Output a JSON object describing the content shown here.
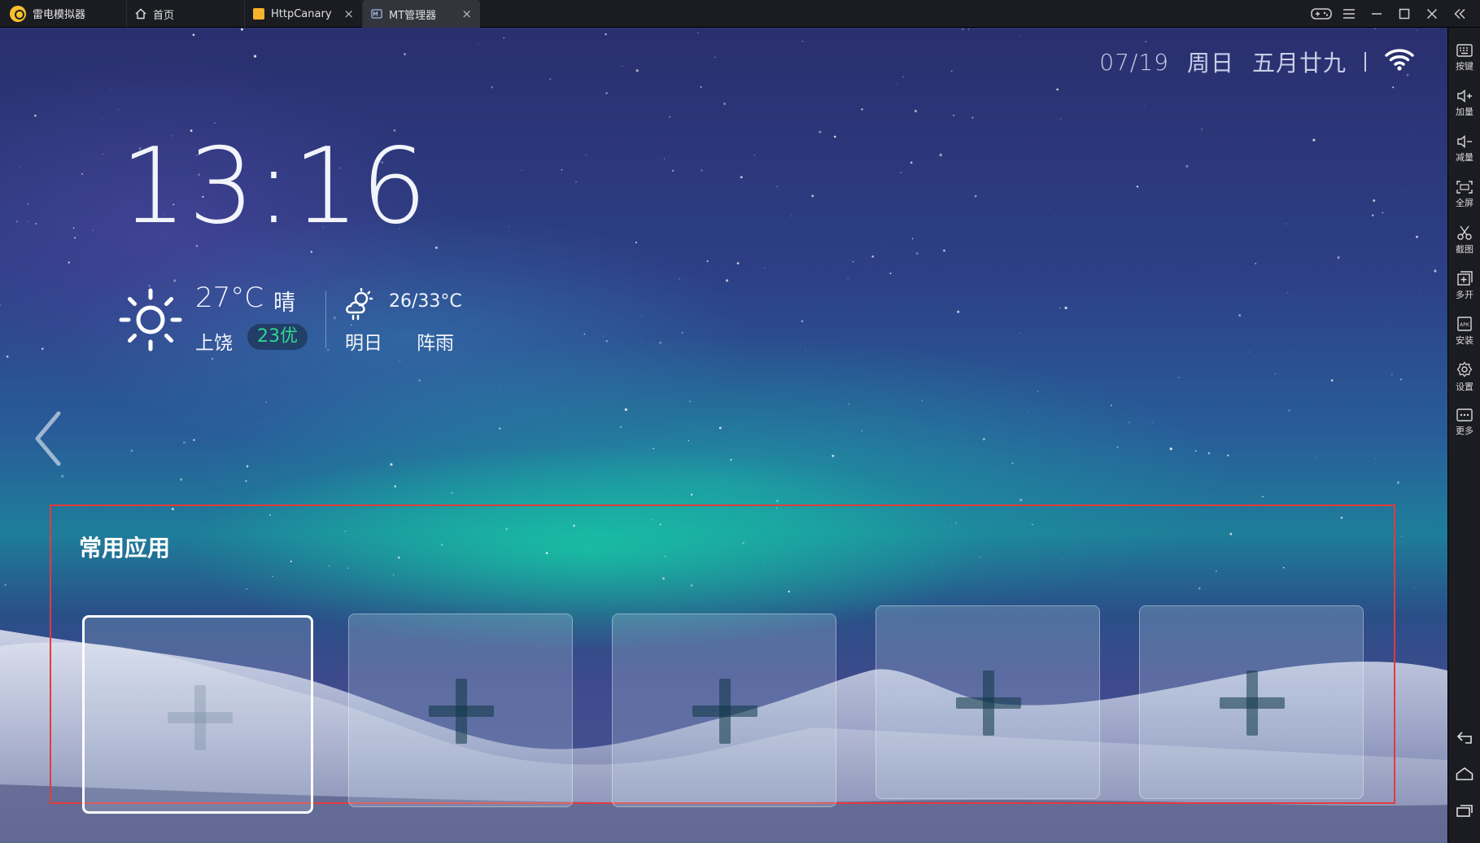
{
  "titlebar": {
    "app_name": "雷电模拟器",
    "tabs": [
      {
        "label": "首页",
        "icon": "home-icon",
        "active": false,
        "closable": false
      },
      {
        "label": "HttpCanary",
        "icon": "httpcanary-icon",
        "active": false,
        "closable": true
      },
      {
        "label": "MT管理器",
        "icon": "mt-manager-icon",
        "active": true,
        "closable": true
      }
    ],
    "close_glyph": "×",
    "window_controls": [
      "gamepad-icon",
      "menu-icon",
      "minimize-icon",
      "maximize-icon",
      "close-icon",
      "collapse-sidebar-icon"
    ]
  },
  "sidebar": {
    "items": [
      {
        "label": "按键",
        "icon": "keyboard-icon"
      },
      {
        "label": "加量",
        "icon": "volume-up-icon"
      },
      {
        "label": "减量",
        "icon": "volume-down-icon"
      },
      {
        "label": "全屏",
        "icon": "fullscreen-icon"
      },
      {
        "label": "截图",
        "icon": "scissors-icon"
      },
      {
        "label": "多开",
        "icon": "multi-instance-icon"
      },
      {
        "label": "安装",
        "icon": "apk-install-icon"
      },
      {
        "label": "设置",
        "icon": "gear-icon"
      },
      {
        "label": "更多",
        "icon": "more-icon"
      }
    ],
    "nav": [
      "back-icon",
      "home-icon",
      "recents-icon"
    ]
  },
  "launcher": {
    "date": "07/19",
    "weekday": "周日",
    "lunar": "五月廿九",
    "clock": "13:16",
    "weather": {
      "temp": "27°C",
      "condition": "晴",
      "city": "上饶",
      "aqi": "23优",
      "tomorrow_range": "26/33°C",
      "tomorrow_label": "明日",
      "tomorrow_condition": "阵雨"
    },
    "dock": {
      "title": "常用应用",
      "slots": 5
    }
  },
  "colors": {
    "highlight_border": "#e23b3b",
    "aqi_green": "#2fd692",
    "titlebar_bg": "#1b1c21"
  }
}
